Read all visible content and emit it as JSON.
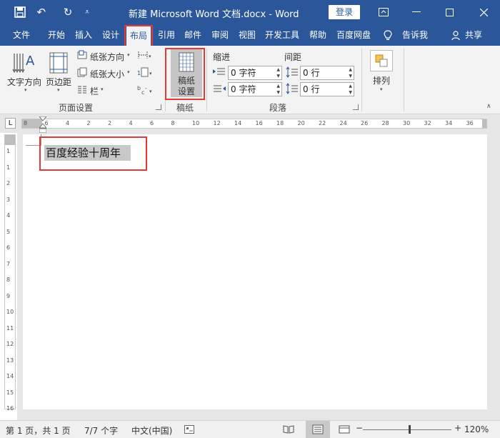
{
  "titlebar": {
    "title": "新建 Microsoft Word 文档.docx  -  Word",
    "login": "登录",
    "save_icon": "save-icon",
    "undo_icon": "undo-icon",
    "redo_icon": "redo-icon"
  },
  "tabs": {
    "file": "文件",
    "home": "开始",
    "insert": "插入",
    "design": "设计",
    "layout": "布局",
    "references": "引用",
    "mailings": "邮件",
    "review": "审阅",
    "view": "视图",
    "developer": "开发工具",
    "help": "帮助",
    "baidu_pan": "百度网盘",
    "tell_me": "告诉我",
    "share": "共享"
  },
  "ribbon": {
    "text_direction": "文字方向",
    "margins": "页边距",
    "orientation": "纸张方向",
    "size": "纸张大小",
    "columns": "栏",
    "group_page_setup": "页面设置",
    "draft_settings_line1": "稿纸",
    "draft_settings_line2": "设置",
    "group_draft": "稿纸",
    "indent": "缩进",
    "spacing": "间距",
    "indent_left": "0 字符",
    "indent_right": "0 字符",
    "spacing_before": "0 行",
    "spacing_after": "0 行",
    "group_paragraph": "段落",
    "arrange": "排列"
  },
  "ruler": {
    "corner": "L",
    "h_labels": [
      "8",
      "6",
      "4",
      "2",
      "2",
      "4",
      "6",
      "8",
      "10",
      "12",
      "14",
      "16",
      "18",
      "20",
      "22",
      "24",
      "26",
      "28",
      "30",
      "32",
      "34",
      "36"
    ],
    "v_labels": [
      "1",
      "1",
      "2",
      "3",
      "4",
      "5",
      "6",
      "7",
      "8",
      "9",
      "10",
      "11",
      "12",
      "13",
      "14",
      "15",
      "16"
    ]
  },
  "document": {
    "text": "百度经验十周年"
  },
  "statusbar": {
    "page": "第 1 页，共 1 页",
    "words": "7/7 个字",
    "language": "中文(中国)",
    "zoom": "120%",
    "minus": "−",
    "plus": "+"
  },
  "colors": {
    "accent": "#2b579a",
    "highlight": "#e53935"
  }
}
